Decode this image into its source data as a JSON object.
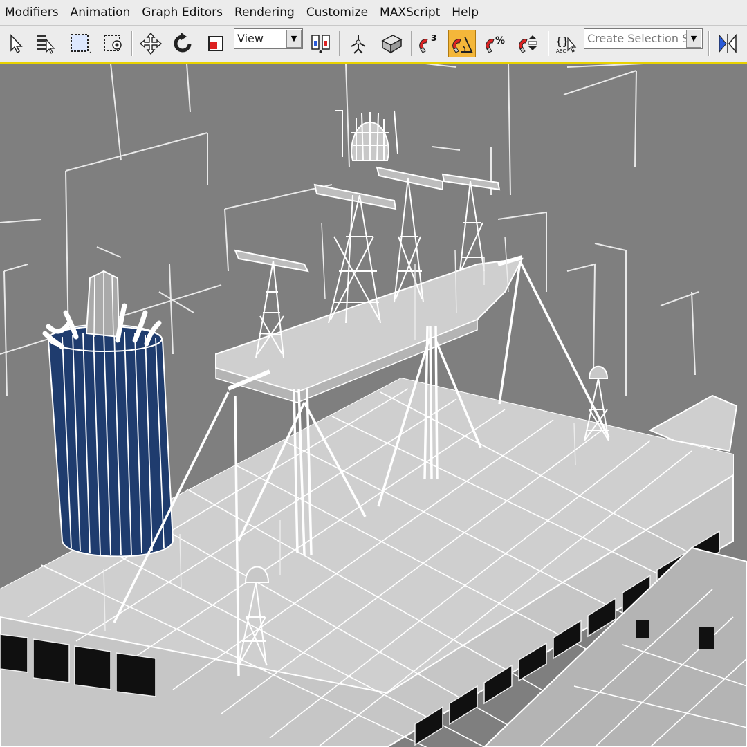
{
  "menu": {
    "items": [
      "Modifiers",
      "Animation",
      "Graph Editors",
      "Rendering",
      "Customize",
      "MAXScript",
      "Help"
    ]
  },
  "toolbar": {
    "view_dropdown": "View",
    "selection_set_placeholder": "Create Selection Set",
    "active_tool": "angle-snap",
    "accent_color": "#f4b73a",
    "highlight_line_color": "#e8d200"
  },
  "viewport": {
    "background_color": "#7f7f7f",
    "wireframe_color": "#ffffff",
    "selected_object_color": "#1f3c6e"
  }
}
